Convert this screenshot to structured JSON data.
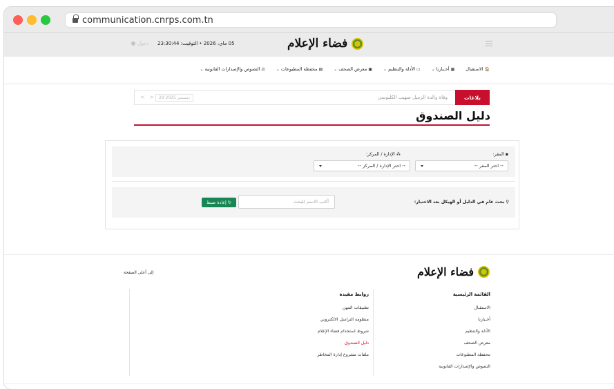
{
  "browser": {
    "url": "communication.cnrps.com.tn"
  },
  "topbar": {
    "brand": "فضاء الإعلام",
    "date_time": "05 ماي، 2026 • التوقيت: 23:30:44",
    "user": "دخول"
  },
  "nav": {
    "items": [
      {
        "icon": "🏠",
        "label": "الاستقبال"
      },
      {
        "icon": "▦",
        "label": "أخـبارنا"
      },
      {
        "icon": "▭",
        "label": "الأدلة والتنظيم"
      },
      {
        "icon": "▣",
        "label": "معرض الصحف"
      },
      {
        "icon": "▤",
        "label": "محفظة المطبوعات"
      },
      {
        "icon": "⚖",
        "label": "النصوص والإصدارات القانونية"
      }
    ]
  },
  "ticker": {
    "label": "بلاغات",
    "text": "وفاة والدة الزميل صهيب الكلبوسي",
    "date": "29 ديسمبر 2025",
    "arrows": "<  >"
  },
  "heading": {
    "title": "دليل الصندوق"
  },
  "filters": {
    "headquarters_label": "المقر:",
    "headquarters_placeholder": "-- اختر المقر --",
    "department_label": "الإدارة / المركز:",
    "department_placeholder": "-- اختر الإدارة / المركز --"
  },
  "search": {
    "label": "بحث عام في الدليل أو الهيكل بعد الاختيار:",
    "placeholder": "أكتب الاسم للبحث",
    "reset_label": "إعادة ضبط"
  },
  "footer": {
    "brand": "فضاء الإعلام",
    "back_to_top": "إلى أعلى الصفحة",
    "main_menu": {
      "title": "القائمة الرئيسية",
      "items": [
        "الاستقبال",
        "أخـبارنا",
        "الأدلة والتنظيم",
        "معرض الصحف",
        "محفظة المطبوعات",
        "النصوص والإصدارات القانونية"
      ]
    },
    "useful_links": {
      "title": "روابط مفيدة",
      "items": [
        "تطبيقات المهن",
        "منظومة التراسل الالكتروني",
        "شروط استخدام فضاء الإعلام",
        "دليل الصندوق",
        "ملفات مشروع إدارة المخاطر"
      ]
    }
  },
  "colors": {
    "accent": "#c8102e",
    "success": "#198754"
  }
}
